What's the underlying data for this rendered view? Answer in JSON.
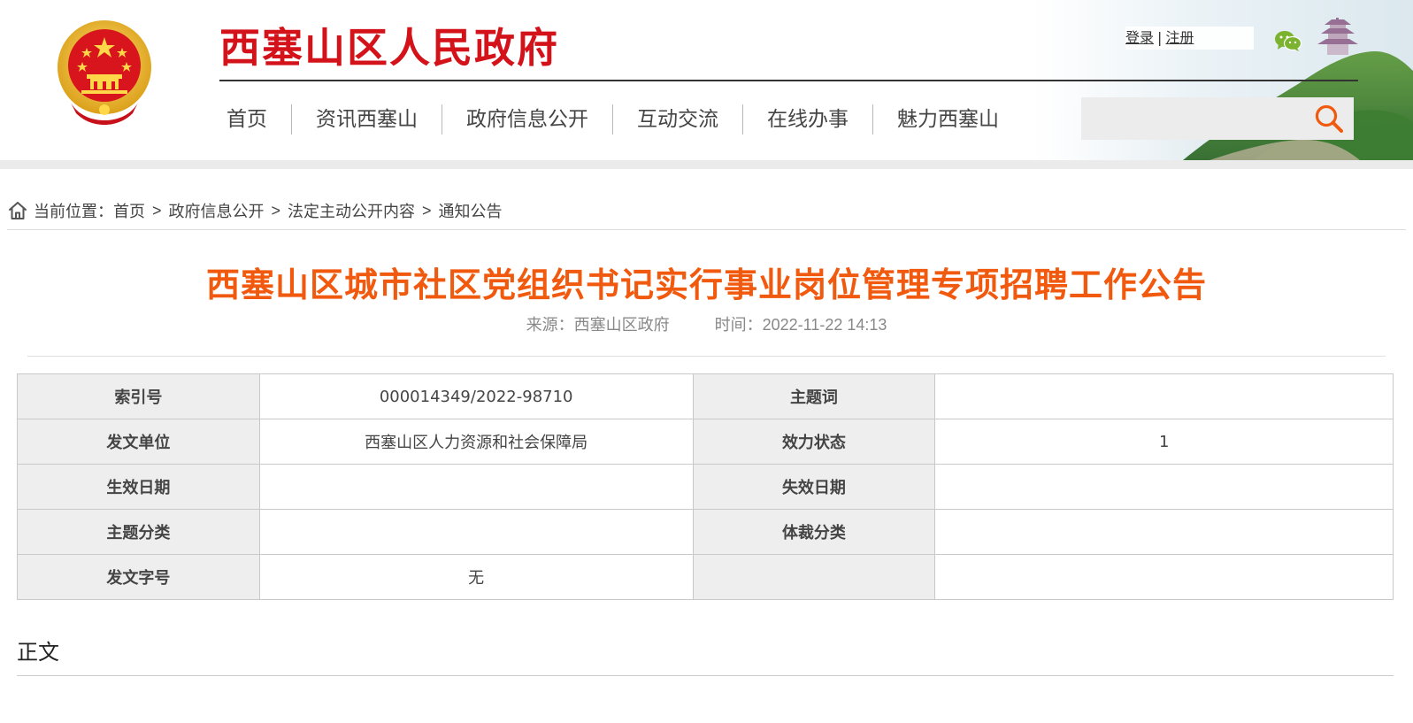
{
  "header": {
    "site_title": "西塞山区人民政府",
    "auth": {
      "login": "登录",
      "separator": "|",
      "register": "注册"
    },
    "nav": [
      {
        "label": "首页"
      },
      {
        "label": "资讯西塞山"
      },
      {
        "label": "政府信息公开"
      },
      {
        "label": "互动交流"
      },
      {
        "label": "在线办事"
      },
      {
        "label": "魅力西塞山"
      }
    ],
    "search": {
      "value": "",
      "icon": "search-icon"
    },
    "icons": {
      "emblem": "national-emblem-icon",
      "wechat": "wechat-icon",
      "scenery": "pagoda-hill-scenery"
    }
  },
  "breadcrumb": {
    "prefix": "当前位置：",
    "items": [
      "首页",
      "政府信息公开",
      "法定主动公开内容",
      "通知公告"
    ],
    "separator": ">"
  },
  "article": {
    "title": "西塞山区城市社区党组织书记实行事业岗位管理专项招聘工作公告",
    "source": "来源：西塞山区政府",
    "time": "时间：2022-11-22 14:13"
  },
  "info_table": {
    "rows": [
      {
        "k1": "索引号",
        "v1": "000014349/2022-98710",
        "k2": "主题词",
        "v2": ""
      },
      {
        "k1": "发文单位",
        "v1": "西塞山区人力资源和社会保障局",
        "k2": "效力状态",
        "v2": "1"
      },
      {
        "k1": "生效日期",
        "v1": "",
        "k2": "失效日期",
        "v2": ""
      },
      {
        "k1": "主题分类",
        "v1": "",
        "k2": "体裁分类",
        "v2": ""
      },
      {
        "k1": "发文字号",
        "v1": "无",
        "k2": "",
        "v2": ""
      }
    ]
  },
  "body": {
    "heading": "正文"
  },
  "colors": {
    "site_title": "#d3121a",
    "article_title": "#f15a0e",
    "search_icon": "#f15a0e",
    "table_key_bg": "#eeeeee",
    "wechat": "#7bb32e"
  }
}
